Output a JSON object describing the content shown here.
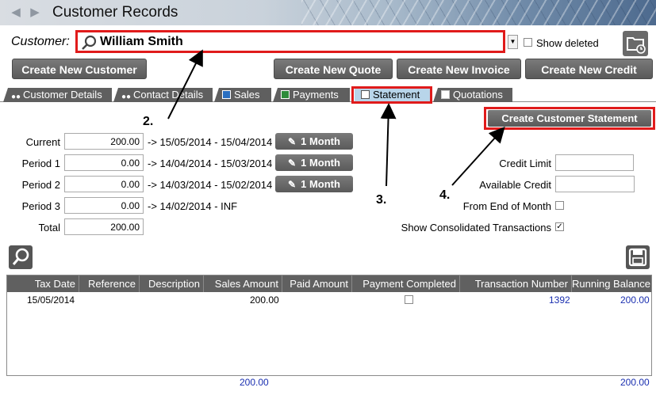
{
  "window": {
    "title": "Customer Records"
  },
  "customer": {
    "label": "Customer:",
    "value": "William Smith",
    "show_deleted_label": "Show deleted",
    "show_deleted_checked": false
  },
  "actions": {
    "create_customer": "Create New Customer",
    "create_quote": "Create New Quote",
    "create_invoice": "Create New Invoice",
    "create_credit": "Create New Credit"
  },
  "tabs": [
    {
      "label": "Customer Details",
      "icon": "people-icon"
    },
    {
      "label": "Contact Details",
      "icon": "people-icon"
    },
    {
      "label": "Sales",
      "icon": "sales-icon"
    },
    {
      "label": "Payments",
      "icon": "payments-icon"
    },
    {
      "label": "Statement",
      "icon": "statement-icon"
    },
    {
      "label": "Quotations",
      "icon": "quotations-icon"
    }
  ],
  "active_tab": "Statement",
  "statement": {
    "periods": [
      {
        "label": "Current",
        "value": "200.00",
        "range": "-> 15/05/2014 - 15/04/2014",
        "button": "1 Month"
      },
      {
        "label": "Period 1",
        "value": "0.00",
        "range": "-> 14/04/2014 - 15/03/2014",
        "button": "1 Month"
      },
      {
        "label": "Period 2",
        "value": "0.00",
        "range": "-> 14/03/2014 - 15/02/2014",
        "button": "1 Month"
      },
      {
        "label": "Period 3",
        "value": "0.00",
        "range": "-> 14/02/2014 - INF"
      }
    ],
    "total_label": "Total",
    "total_value": "200.00",
    "create_statement_button": "Create Customer Statement",
    "credit_limit_label": "Credit Limit",
    "available_credit_label": "Available Credit",
    "from_end_of_month_label": "From End of Month",
    "from_end_of_month_checked": false,
    "show_consolidated_label": "Show Consolidated Transactions",
    "show_consolidated_checked": true
  },
  "annotations": [
    "2.",
    "3.",
    "4."
  ],
  "grid": {
    "columns": [
      "Tax Date",
      "Reference",
      "Description",
      "Sales Amount",
      "Paid Amount",
      "Payment Completed",
      "Transaction Number",
      "Running Balance"
    ],
    "rows": [
      {
        "tax_date": "15/05/2014",
        "reference": "",
        "description": "",
        "sales_amount": "200.00",
        "paid_amount": "",
        "payment_completed": false,
        "transaction_number": "1392",
        "running_balance": "200.00"
      }
    ],
    "footer_sales_total": "200.00",
    "footer_balance_total": "200.00"
  },
  "colors": {
    "highlight": "#e01b1b",
    "button": "#5f5f5f",
    "active_tab": "#b8d5ea",
    "link_blue": "#1a2fb0"
  }
}
